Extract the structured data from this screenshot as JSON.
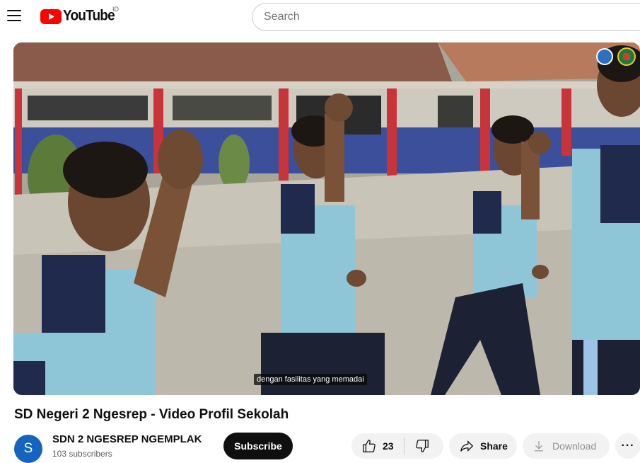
{
  "header": {
    "logo_text": "YouTube",
    "region_code": "ID",
    "search_placeholder": "Search"
  },
  "player": {
    "caption": "dengan fasilitas yang memadai"
  },
  "video": {
    "title": "SD Negeri 2 Ngesrep - Video Profil Sekolah"
  },
  "channel": {
    "avatar_letter": "S",
    "name": "SDN 2 NGESREP NGEMPLAK",
    "subscribers": "103 subscribers",
    "subscribe_label": "Subscribe"
  },
  "actions": {
    "like_count": "23",
    "share_label": "Share",
    "download_label": "Download",
    "more_label": "···"
  },
  "colors": {
    "brand_red": "#ff0000",
    "subscribe_bg": "#0f0f0f",
    "pill_bg": "#f2f2f2",
    "avatar_bg": "#1565c0"
  }
}
